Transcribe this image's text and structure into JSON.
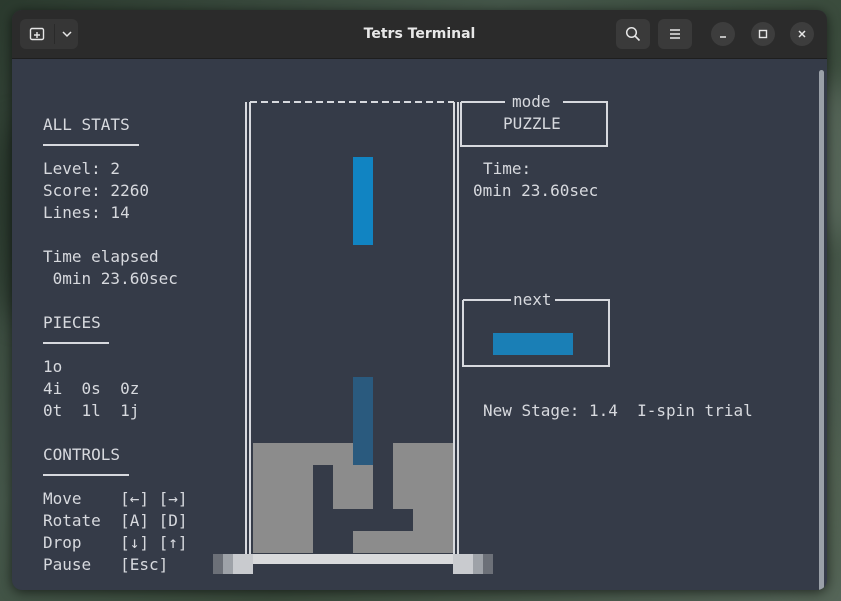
{
  "window": {
    "title": "Tetrs Terminal"
  },
  "titlebar": {
    "new_tab_icon": "new-tab-icon",
    "dropdown_icon": "chevron-down-icon",
    "search_icon": "search-icon",
    "menu_icon": "hamburger-menu-icon",
    "minimize_icon": "minimize-icon",
    "maximize_icon": "maximize-icon",
    "close_icon": "close-icon"
  },
  "stats": {
    "heading": "ALL STATS",
    "level": "Level: 2",
    "score": "Score: 2260",
    "lines": "Lines: 14",
    "time_heading": "Time elapsed",
    "time_value": " 0min 23.60sec"
  },
  "pieces": {
    "heading": "PIECES",
    "row1": "1o",
    "row2": "4i  0s  0z",
    "row3": "0t  1l  1j"
  },
  "controls": {
    "heading": "CONTROLS",
    "rows": [
      "Move    [←] [→]",
      "Rotate  [A] [D]",
      "Drop    [↓] [↑]",
      "Pause   [Esc]"
    ]
  },
  "mode": {
    "label": "mode",
    "value": "PUZZLE"
  },
  "timer": {
    "label": "Time:",
    "value": "0min 23.60sec"
  },
  "next": {
    "label": "next"
  },
  "stage_message": "New Stage: 1.4  I-spin trial",
  "colors": {
    "terminal_bg": "#353b48",
    "text": "#d7d9de",
    "active_piece": "#1184c2",
    "ghost_piece": "#2a5a7e",
    "locked_cells": "#8c8c8c",
    "next_piece": "#1a7fb6"
  }
}
